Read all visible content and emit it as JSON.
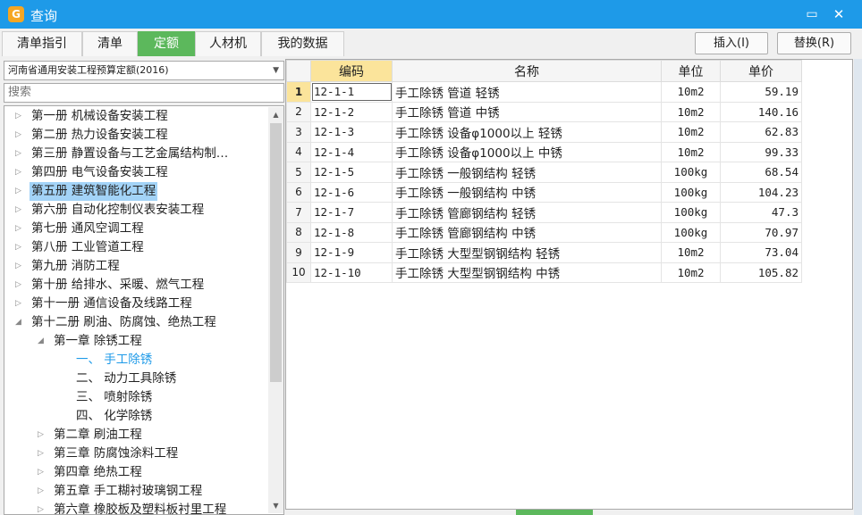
{
  "window": {
    "title": "查询",
    "icon_letter": "G",
    "max_icon": "▭",
    "close_icon": "✕"
  },
  "tabs": [
    {
      "label": "清单指引",
      "active": false
    },
    {
      "label": "清单",
      "active": false
    },
    {
      "label": "定额",
      "active": true
    },
    {
      "label": "人材机",
      "active": false
    },
    {
      "label": "我的数据",
      "active": false
    }
  ],
  "toolbar": {
    "insert_label": "插入(I)",
    "replace_label": "替换(R)"
  },
  "left": {
    "quota_select": "河南省通用安装工程预算定额(2016)",
    "search_placeholder": "搜索"
  },
  "tree": [
    {
      "label": "第一册 机械设备安装工程",
      "arrow": "▷",
      "level": 0
    },
    {
      "label": "第二册 热力设备安装工程",
      "arrow": "▷",
      "level": 0
    },
    {
      "label": "第三册 静置设备与工艺金属结构制…",
      "arrow": "▷",
      "level": 0
    },
    {
      "label": "第四册 电气设备安装工程",
      "arrow": "▷",
      "level": 0
    },
    {
      "label": "第五册 建筑智能化工程",
      "arrow": "▷",
      "level": 0,
      "selected": true
    },
    {
      "label": "第六册 自动化控制仪表安装工程",
      "arrow": "▷",
      "level": 0
    },
    {
      "label": "第七册 通风空调工程",
      "arrow": "▷",
      "level": 0
    },
    {
      "label": "第八册 工业管道工程",
      "arrow": "▷",
      "level": 0
    },
    {
      "label": "第九册 消防工程",
      "arrow": "▷",
      "level": 0
    },
    {
      "label": "第十册 给排水、采暖、燃气工程",
      "arrow": "▷",
      "level": 0
    },
    {
      "label": "第十一册 通信设备及线路工程",
      "arrow": "▷",
      "level": 0
    },
    {
      "label": "第十二册 刷油、防腐蚀、绝热工程",
      "arrow": "◢",
      "level": 0
    },
    {
      "label": "第一章 除锈工程",
      "arrow": "◢",
      "level": 1
    },
    {
      "label": "一、 手工除锈",
      "arrow": "",
      "level": 2,
      "highlight": true
    },
    {
      "label": "二、 动力工具除锈",
      "arrow": "",
      "level": 2
    },
    {
      "label": "三、 喷射除锈",
      "arrow": "",
      "level": 2
    },
    {
      "label": "四、 化学除锈",
      "arrow": "",
      "level": 2
    },
    {
      "label": "第二章 刷油工程",
      "arrow": "▷",
      "level": 1
    },
    {
      "label": "第三章 防腐蚀涂料工程",
      "arrow": "▷",
      "level": 1
    },
    {
      "label": "第四章 绝热工程",
      "arrow": "▷",
      "level": 1
    },
    {
      "label": "第五章 手工糊衬玻璃钢工程",
      "arrow": "▷",
      "level": 1
    },
    {
      "label": "第六章 橡胶板及塑料板衬里工程",
      "arrow": "▷",
      "level": 1
    }
  ],
  "table": {
    "headers": {
      "code": "编码",
      "name": "名称",
      "unit": "单位",
      "price": "单价"
    },
    "rows": [
      {
        "idx": "1",
        "code": "12-1-1",
        "name": "手工除锈 管道 轻锈",
        "unit": "10m2",
        "price": "59.19"
      },
      {
        "idx": "2",
        "code": "12-1-2",
        "name": "手工除锈 管道 中锈",
        "unit": "10m2",
        "price": "140.16"
      },
      {
        "idx": "3",
        "code": "12-1-3",
        "name": "手工除锈 设备φ1000以上 轻锈",
        "unit": "10m2",
        "price": "62.83"
      },
      {
        "idx": "4",
        "code": "12-1-4",
        "name": "手工除锈 设备φ1000以上 中锈",
        "unit": "10m2",
        "price": "99.33"
      },
      {
        "idx": "5",
        "code": "12-1-5",
        "name": "手工除锈 一般钢结构 轻锈",
        "unit": "100kg",
        "price": "68.54"
      },
      {
        "idx": "6",
        "code": "12-1-6",
        "name": "手工除锈 一般钢结构 中锈",
        "unit": "100kg",
        "price": "104.23"
      },
      {
        "idx": "7",
        "code": "12-1-7",
        "name": "手工除锈 管廊钢结构 轻锈",
        "unit": "100kg",
        "price": "47.3"
      },
      {
        "idx": "8",
        "code": "12-1-8",
        "name": "手工除锈 管廊钢结构 中锈",
        "unit": "100kg",
        "price": "70.97"
      },
      {
        "idx": "9",
        "code": "12-1-9",
        "name": "手工除锈 大型型钢钢结构 轻锈",
        "unit": "10m2",
        "price": "73.04"
      },
      {
        "idx": "10",
        "code": "12-1-10",
        "name": "手工除锈 大型型钢钢结构 中锈",
        "unit": "10m2",
        "price": "105.82"
      }
    ]
  },
  "colors": {
    "titlebar": "#1e9ae8",
    "active_tab": "#5cb85c",
    "selected_row": "#a3d3f7",
    "header_highlight": "#fbe49b"
  }
}
